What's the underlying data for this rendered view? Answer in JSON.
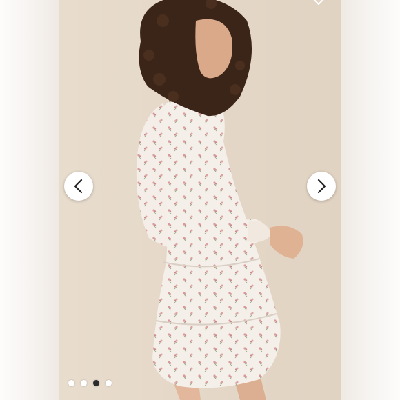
{
  "carousel": {
    "total_slides": 4,
    "active_index": 2,
    "icons": {
      "prev": "chevron-left-icon",
      "next": "chevron-right-icon",
      "favorite": "heart-icon"
    },
    "colors": {
      "backdrop": "#e4d7c7",
      "button_bg": "#ffffff",
      "chevron": "#222222",
      "dot_inactive": "#ffffff",
      "dot_active": "#2b2b2b"
    }
  }
}
